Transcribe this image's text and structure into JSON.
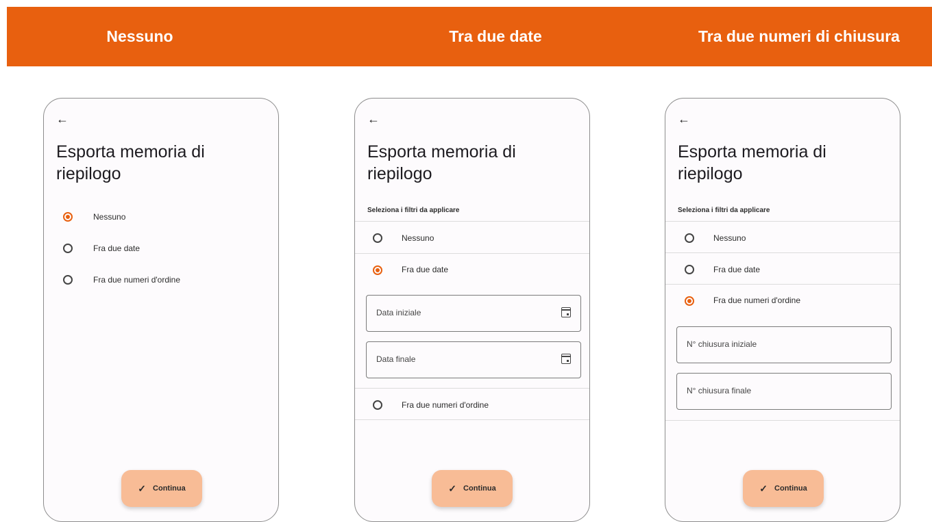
{
  "header": {
    "columns": [
      "Nessuno",
      "Tra due date",
      "Tra due numeri di chiusura"
    ]
  },
  "screen": {
    "title": "Esporta memoria di riepilogo",
    "filter_label": "Seleziona i filtri da applicare",
    "continue_label": "Continua",
    "options": [
      "Nessuno",
      "Fra due date",
      "Fra due numeri d'ordine"
    ]
  },
  "panel_dates": {
    "start_placeholder": "Data iniziale",
    "end_placeholder": "Data finale"
  },
  "panel_numbers": {
    "start_placeholder": "N° chiusura iniziale",
    "end_placeholder": "N° chiusura finale"
  },
  "selected_option": {
    "panel1": "Nessuno",
    "panel2": "Fra due date",
    "panel3": "Fra due numeri d'ordine"
  },
  "colors": {
    "accent": "#e8600f",
    "button_bg": "#f8bc96"
  },
  "icons": [
    "arrow-back-icon",
    "radio-icon",
    "calendar-icon",
    "check-icon"
  ]
}
